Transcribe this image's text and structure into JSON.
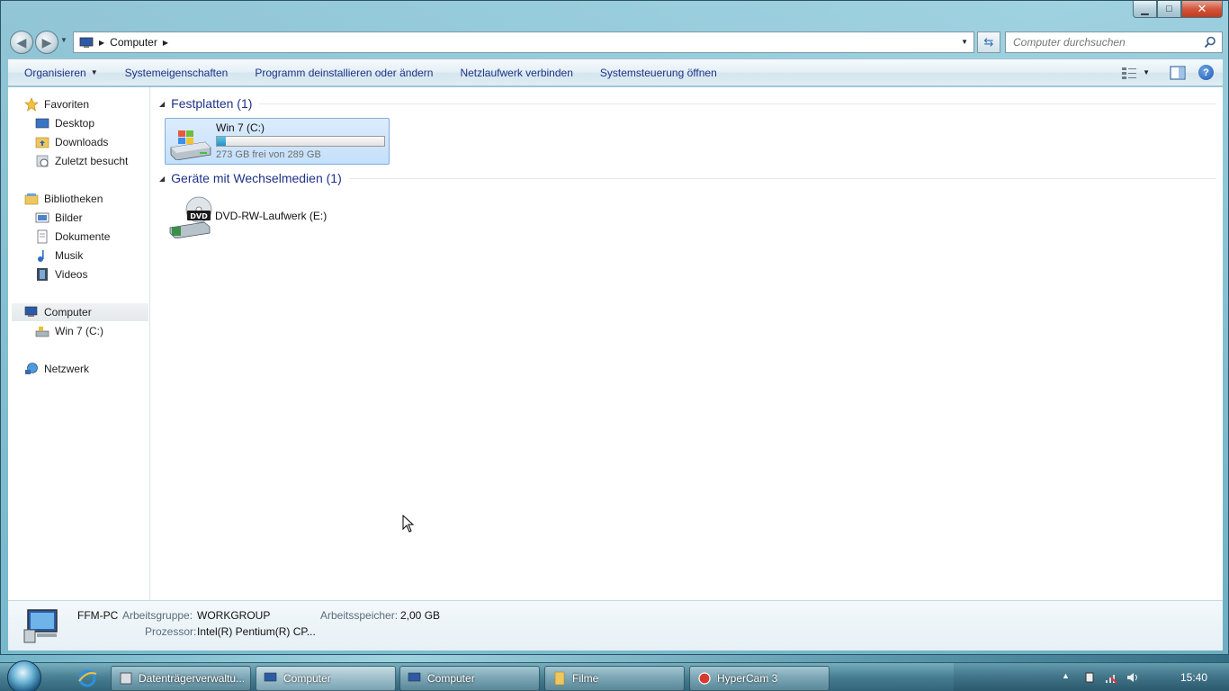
{
  "window": {
    "caption": {
      "minimize": "▁",
      "maximize": "□",
      "close": "✕"
    }
  },
  "address": {
    "path": "Computer",
    "search_placeholder": "Computer durchsuchen"
  },
  "commands": {
    "organize": "Organisieren",
    "system_properties": "Systemeigenschaften",
    "uninstall": "Programm deinstallieren oder ändern",
    "map_drive": "Netzlaufwerk verbinden",
    "control_panel": "Systemsteuerung öffnen"
  },
  "nav": {
    "favorites": "Favoriten",
    "desktop": "Desktop",
    "downloads": "Downloads",
    "recent": "Zuletzt besucht",
    "libraries": "Bibliotheken",
    "pictures": "Bilder",
    "documents": "Dokumente",
    "music": "Musik",
    "videos": "Videos",
    "computer": "Computer",
    "drive_c": "Win 7 (C:)",
    "network": "Netzwerk"
  },
  "groups": {
    "hard_disks": "Festplatten (1)",
    "removable": "Geräte mit Wechselmedien (1)"
  },
  "drive_c": {
    "name": "Win 7 (C:)",
    "free_text": "273 GB frei von 289 GB",
    "used_fraction": 0.055
  },
  "dvd": {
    "name": "DVD-RW-Laufwerk (E:)",
    "badge": "DVD"
  },
  "details": {
    "pc_name": "FFM-PC",
    "workgroup_label": "Arbeitsgruppe:",
    "workgroup_value": "WORKGROUP",
    "memory_label": "Arbeitsspeicher:",
    "memory_value": "2,00 GB",
    "cpu_label": "Prozessor:",
    "cpu_value": "Intel(R) Pentium(R) CP..."
  },
  "taskbar": {
    "items": [
      {
        "label": "Datenträgerverwaltu..."
      },
      {
        "label": "Computer"
      },
      {
        "label": "Computer"
      },
      {
        "label": "Filme"
      },
      {
        "label": "HyperCam 3"
      }
    ],
    "clock": "15:40"
  },
  "colors": {
    "link_blue": "#1e3287",
    "selection": "#c4e0fb",
    "bar_fill": "#2990c7"
  }
}
